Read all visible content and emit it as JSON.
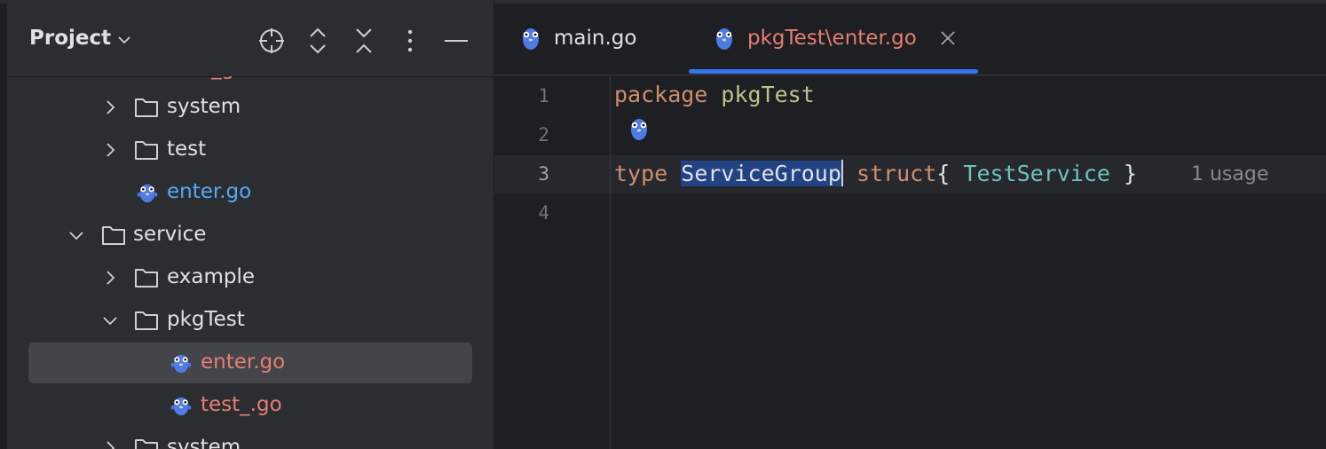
{
  "project_panel": {
    "title": "Project",
    "toolbar": [
      "locate-icon",
      "expand-all-icon",
      "collapse-all-icon",
      "more-icon",
      "hide-icon"
    ],
    "tree": [
      {
        "label": "system",
        "type": "folder",
        "expanded": false,
        "depth": 2
      },
      {
        "label": "test",
        "type": "folder",
        "expanded": false,
        "depth": 2
      },
      {
        "label": "enter.go",
        "type": "go-file",
        "status": "modified",
        "depth": 2
      },
      {
        "label": "service",
        "type": "folder",
        "expanded": true,
        "depth": 1
      },
      {
        "label": "example",
        "type": "folder",
        "expanded": false,
        "depth": 2
      },
      {
        "label": "pkgTest",
        "type": "folder",
        "expanded": true,
        "depth": 2
      },
      {
        "label": "enter.go",
        "type": "go-file",
        "status": "new",
        "selected": true,
        "depth": 3
      },
      {
        "label": "test_.go",
        "type": "go-file",
        "status": "new",
        "depth": 3
      },
      {
        "label": "system",
        "type": "folder",
        "expanded": false,
        "depth": 2
      }
    ]
  },
  "editor": {
    "tabs": [
      {
        "label": "main.go",
        "active": false
      },
      {
        "label": "pkgTest\\enter.go",
        "active": true
      }
    ],
    "line_numbers": [
      "1",
      "2",
      "3",
      "4"
    ],
    "current_line": 3,
    "code": {
      "line1": {
        "keyword": "package",
        "name": "pkgTest"
      },
      "line3": {
        "keyword": "type",
        "selected": "ServiceGroup",
        "keyword2": "struct",
        "open": "{",
        "field": "TestService",
        "close": "}"
      },
      "inlay_hint": "1 usage"
    }
  },
  "colors": {
    "background": "#1e1f22",
    "panel": "#2b2d30",
    "accent": "#3574f0",
    "keyword": "#cf8e6d",
    "package_name": "#b3c78f",
    "new_file": "#e67e73",
    "modified_file": "#56a8f5",
    "selection": "#214283"
  }
}
